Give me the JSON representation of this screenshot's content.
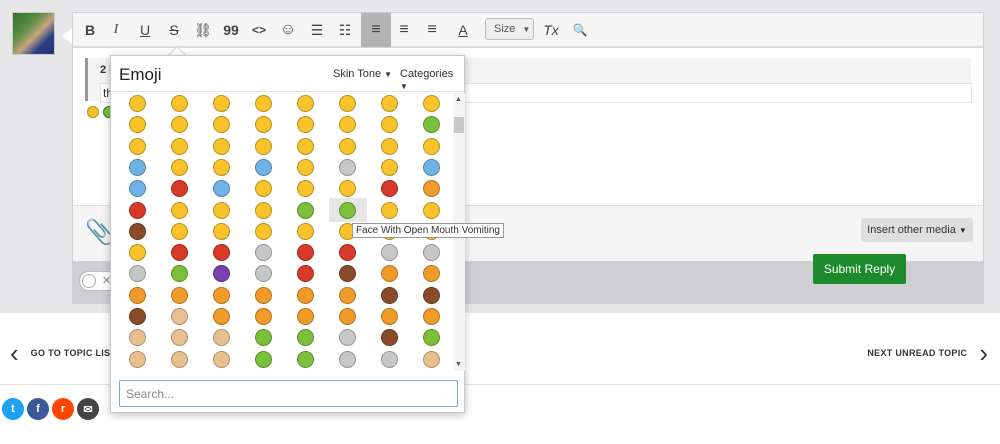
{
  "toolbar": {
    "bold": "B",
    "italic": "I",
    "underline": "U",
    "strike": "S",
    "link": "⛓",
    "quote": "99",
    "code": "<>",
    "emoji": "☺",
    "bullets": "☰",
    "numbers": "☷",
    "align_left": "≡",
    "align_center": "≡",
    "align_right": "≡",
    "text_color": "A",
    "size_label": "Size",
    "clear": "Tx",
    "preview": "🔍"
  },
  "quote": {
    "header": "2 h",
    "body": "the"
  },
  "attach": {
    "insert_media_label": "Insert other media"
  },
  "submit_label": "Submit Reply",
  "nav": {
    "prev_label": "GO TO TOPIC LISTI",
    "next_label": "NEXT UNREAD TOPIC"
  },
  "picker": {
    "title": "Emoji",
    "skin_tone_label": "Skin Tone",
    "categories_label": "Categories",
    "tooltip": "Face With Open Mouth Vomiting",
    "search_placeholder": "Search...",
    "colors": {
      "yellow": "#f7c22a",
      "red": "#d83a2a",
      "blue": "#6fb3e6",
      "green": "#7cbf3a",
      "brown": "#8a4b2a",
      "grey": "#c7c7c7",
      "purple": "#7a3fb0",
      "orange": "#f09a2a",
      "tan": "#e8c090"
    }
  },
  "share": [
    {
      "name": "twitter",
      "color": "#1da1f2",
      "glyph": "t"
    },
    {
      "name": "facebook",
      "color": "#3b5998",
      "glyph": "f"
    },
    {
      "name": "reddit",
      "color": "#ff4500",
      "glyph": "r"
    },
    {
      "name": "email",
      "color": "#444444",
      "glyph": "✉"
    }
  ]
}
